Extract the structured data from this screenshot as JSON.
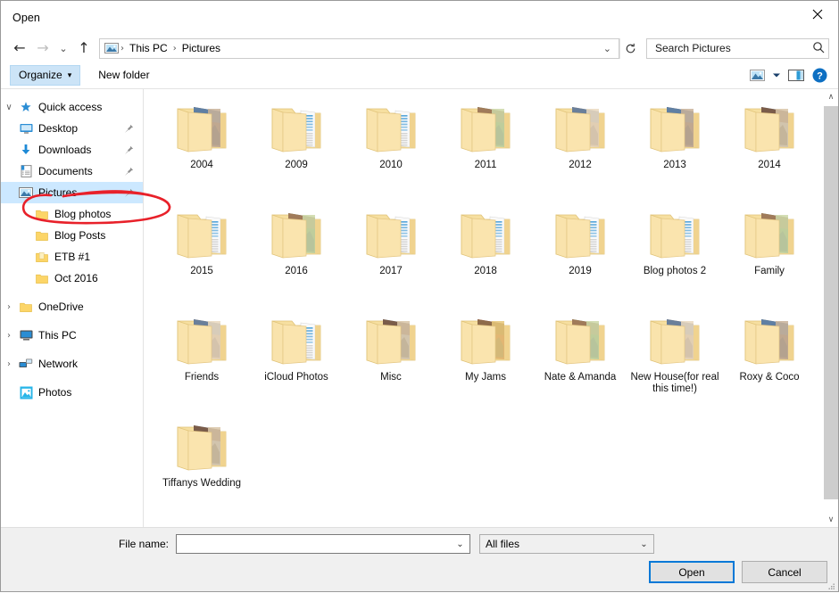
{
  "window": {
    "title": "Open",
    "close_icon": "close-icon"
  },
  "nav": {
    "back_icon": "back-arrow-icon",
    "forward_icon": "forward-arrow-icon",
    "recent_icon": "recent-locations-chevron-icon",
    "up_icon": "up-arrow-icon",
    "address_icon": "pictures-folder-icon",
    "breadcrumbs": [
      "This PC",
      "Pictures"
    ],
    "separator": "›",
    "address_dropdown_icon": "chevron-down-icon",
    "refresh_icon": "refresh-icon"
  },
  "search": {
    "placeholder": "Search Pictures",
    "value": "",
    "icon": "search-icon"
  },
  "toolbar": {
    "organize_label": "Organize",
    "organize_caret": "▾",
    "new_folder_label": "New folder",
    "view_icon": "view-mode-icon",
    "view_caret_icon": "chevron-down-icon",
    "preview_pane_icon": "preview-pane-icon",
    "help_icon": "help-icon"
  },
  "sidebar": {
    "items": [
      {
        "label": "Quick access",
        "icon": "star-pin-icon",
        "indent": 0,
        "expander": "∨",
        "pinned": false,
        "selected": false
      },
      {
        "label": "Desktop",
        "icon": "desktop-icon",
        "indent": 1,
        "expander": "",
        "pinned": true,
        "selected": false
      },
      {
        "label": "Downloads",
        "icon": "downloads-icon",
        "indent": 1,
        "expander": "",
        "pinned": true,
        "selected": false
      },
      {
        "label": "Documents",
        "icon": "documents-icon",
        "indent": 1,
        "expander": "",
        "pinned": true,
        "selected": false
      },
      {
        "label": "Pictures",
        "icon": "pictures-icon",
        "indent": 1,
        "expander": "",
        "pinned": true,
        "selected": true
      },
      {
        "label": "Blog photos",
        "icon": "folder-icon",
        "indent": 2,
        "expander": "",
        "pinned": false,
        "selected": false
      },
      {
        "label": "Blog Posts",
        "icon": "folder-icon",
        "indent": 2,
        "expander": "",
        "pinned": false,
        "selected": false
      },
      {
        "label": "ETB #1",
        "icon": "folder-icon",
        "indent": 2,
        "expander": "",
        "pinned": false,
        "selected": false
      },
      {
        "label": "Oct 2016",
        "icon": "folder-icon",
        "indent": 2,
        "expander": "",
        "pinned": false,
        "selected": false
      },
      {
        "label": "OneDrive",
        "icon": "onedrive-folder-icon",
        "indent": 0,
        "expander": "›",
        "pinned": false,
        "selected": false
      },
      {
        "label": "This PC",
        "icon": "this-pc-icon",
        "indent": 0,
        "expander": "›",
        "pinned": false,
        "selected": false
      },
      {
        "label": "Network",
        "icon": "network-icon",
        "indent": 0,
        "expander": "›",
        "pinned": false,
        "selected": false
      },
      {
        "label": "Photos",
        "icon": "photos-app-icon",
        "indent": 0,
        "expander": "",
        "pinned": false,
        "selected": false
      }
    ]
  },
  "files": {
    "items": [
      {
        "name": "2004",
        "type": "folder",
        "thumb": "photo"
      },
      {
        "name": "2009",
        "type": "folder",
        "thumb": "document"
      },
      {
        "name": "2010",
        "type": "folder",
        "thumb": "document"
      },
      {
        "name": "2011",
        "type": "folder",
        "thumb": "photo"
      },
      {
        "name": "2012",
        "type": "folder",
        "thumb": "photo"
      },
      {
        "name": "2013",
        "type": "folder",
        "thumb": "photo"
      },
      {
        "name": "2014",
        "type": "folder",
        "thumb": "photo"
      },
      {
        "name": "2015",
        "type": "folder",
        "thumb": "document"
      },
      {
        "name": "2016",
        "type": "folder",
        "thumb": "photo"
      },
      {
        "name": "2017",
        "type": "folder",
        "thumb": "document"
      },
      {
        "name": "2018",
        "type": "folder",
        "thumb": "document"
      },
      {
        "name": "2019",
        "type": "folder",
        "thumb": "document"
      },
      {
        "name": "Blog photos 2",
        "type": "folder",
        "thumb": "document"
      },
      {
        "name": "Family",
        "type": "folder",
        "thumb": "photo"
      },
      {
        "name": "Friends",
        "type": "folder",
        "thumb": "photo"
      },
      {
        "name": "iCloud Photos",
        "type": "folder",
        "thumb": "document"
      },
      {
        "name": "Misc",
        "type": "folder",
        "thumb": "photo"
      },
      {
        "name": "My Jams",
        "type": "folder",
        "thumb": "photo"
      },
      {
        "name": "Nate & Amanda",
        "type": "folder",
        "thumb": "photo"
      },
      {
        "name": "New House(for real this time!)",
        "type": "folder",
        "thumb": "photo"
      },
      {
        "name": "Roxy & Coco",
        "type": "folder",
        "thumb": "photo"
      },
      {
        "name": "Tiffanys Wedding",
        "type": "folder",
        "thumb": "photo"
      }
    ]
  },
  "scrollbar": {
    "up_arrow": "∧",
    "down_arrow": "∨"
  },
  "footer": {
    "file_name_label": "File name:",
    "file_name_value": "",
    "file_name_dropdown_icon": "chevron-down-icon",
    "filter_value": "All files",
    "filter_dropdown_icon": "chevron-down-icon",
    "open_label": "Open",
    "cancel_label": "Cancel"
  },
  "annotation": {
    "shape": "red-ellipse-highlight",
    "color": "#e8212a",
    "target": "Pictures"
  },
  "colors": {
    "accent": "#0078d7",
    "selection": "#cce8ff",
    "folder": "#f7d98a",
    "annotation_red": "#e8212a"
  }
}
